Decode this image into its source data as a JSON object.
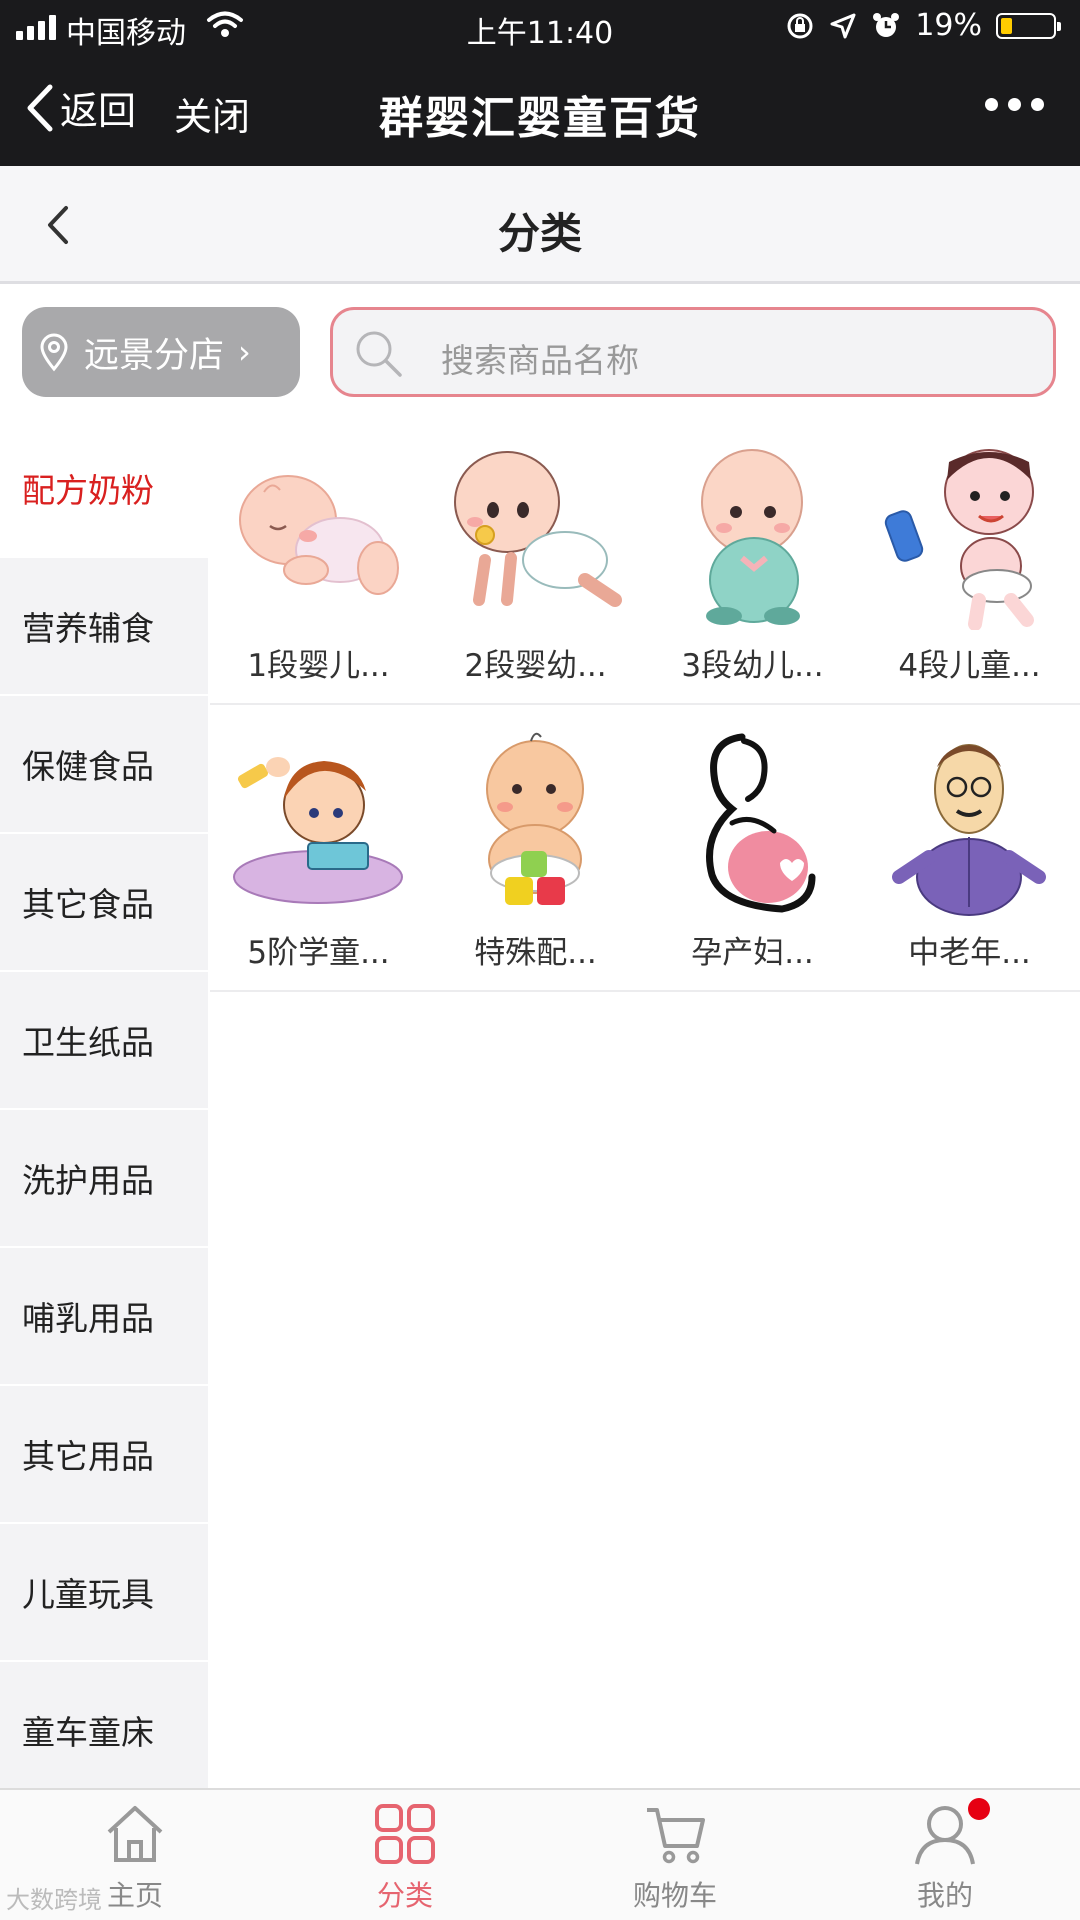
{
  "status_bar": {
    "carrier": "中国移动",
    "time": "上午11:40",
    "battery_percent": "19%",
    "battery_level": 0.19
  },
  "wechat_nav": {
    "back_label": "返回",
    "close_label": "关闭",
    "title": "群婴汇婴童百货"
  },
  "page": {
    "title": "分类"
  },
  "store": {
    "name": "远景分店"
  },
  "search": {
    "placeholder": "搜索商品名称"
  },
  "categories": [
    {
      "label": "配方奶粉",
      "active": true
    },
    {
      "label": "营养辅食"
    },
    {
      "label": "保健食品"
    },
    {
      "label": "其它食品"
    },
    {
      "label": "卫生纸品"
    },
    {
      "label": "洗护用品"
    },
    {
      "label": "哺乳用品"
    },
    {
      "label": "其它用品"
    },
    {
      "label": "儿童玩具"
    },
    {
      "label": "童车童床"
    }
  ],
  "products": [
    {
      "name": "1段婴儿...",
      "icon": "sleeping-baby"
    },
    {
      "name": "2段婴幼...",
      "icon": "crawling-baby"
    },
    {
      "name": "3段幼儿...",
      "icon": "sitting-baby"
    },
    {
      "name": "4段儿童...",
      "icon": "toddler-with-bottle"
    },
    {
      "name": "5阶学童...",
      "icon": "child-reading"
    },
    {
      "name": "特殊配...",
      "icon": "baby-with-blocks"
    },
    {
      "name": "孕产妇...",
      "icon": "pregnant-woman"
    },
    {
      "name": "中老年...",
      "icon": "elderly-man"
    }
  ],
  "tabbar": {
    "items": [
      {
        "label": "主页",
        "icon": "home-icon"
      },
      {
        "label": "分类",
        "icon": "category-grid-icon",
        "active": true
      },
      {
        "label": "购物车",
        "icon": "cart-icon"
      },
      {
        "label": "我的",
        "icon": "profile-icon"
      }
    ]
  },
  "watermark": "大数跨境",
  "colors": {
    "accent": "#d9201f",
    "tab_active": "#e6646f",
    "search_border": "#e6858e",
    "dark_bar": "#1a1a1c"
  }
}
